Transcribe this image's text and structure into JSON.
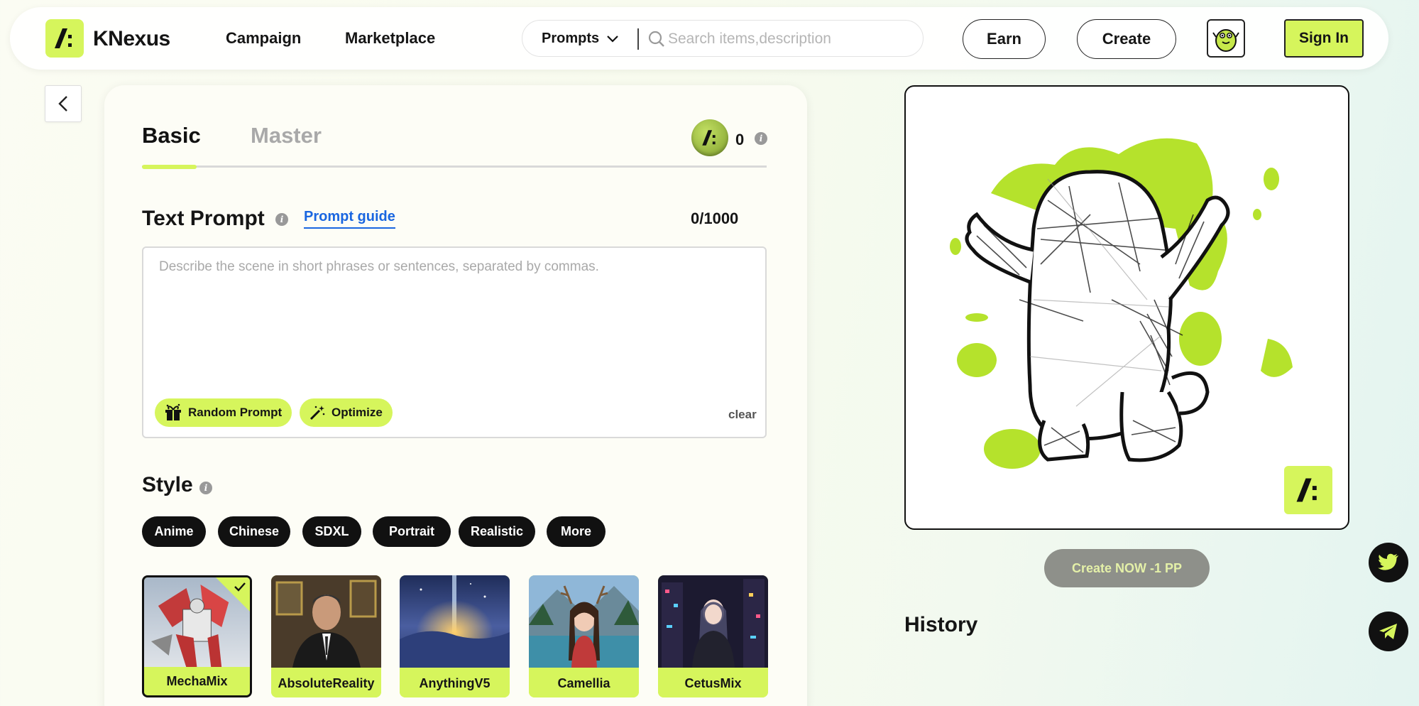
{
  "header": {
    "brand": "KNexus",
    "nav": [
      "Campaign",
      "Marketplace"
    ],
    "search": {
      "category": "Prompts",
      "placeholder": "Search items,description"
    },
    "earn_label": "Earn",
    "create_label": "Create",
    "signin_label": "Sign In"
  },
  "panel": {
    "tabs": {
      "basic": "Basic",
      "master": "Master",
      "active": "Basic"
    },
    "credits": "0",
    "text_prompt": {
      "title": "Text Prompt",
      "guide_link": "Prompt guide",
      "char_count": "0/1000",
      "placeholder": "Describe the scene in short phrases or sentences, separated by commas.",
      "value": "",
      "random_label": "Random Prompt",
      "optimize_label": "Optimize",
      "clear_label": "clear"
    },
    "style": {
      "title": "Style",
      "tags": [
        "Anime",
        "Chinese",
        "SDXL",
        "Portrait",
        "Realistic",
        "More"
      ],
      "models": [
        {
          "name": "MechaMix",
          "selected": true
        },
        {
          "name": "AbsoluteReality",
          "selected": false
        },
        {
          "name": "AnythingV5",
          "selected": false
        },
        {
          "name": "Camellia",
          "selected": false
        },
        {
          "name": "CetusMix",
          "selected": false
        }
      ]
    }
  },
  "preview": {
    "create_button": "Create NOW -1 PP",
    "history_title": "History"
  },
  "colors": {
    "accent": "#d6f55c",
    "dark": "#111111",
    "link": "#1a66e0",
    "disabled_button": "#8e908a"
  },
  "icons": [
    "logo-icon",
    "chevron-down-icon",
    "search-icon",
    "mascot-icon",
    "back-arrow-icon",
    "info-icon",
    "gift-icon",
    "magic-wand-icon",
    "check-icon",
    "twitter-icon",
    "telegram-icon"
  ]
}
